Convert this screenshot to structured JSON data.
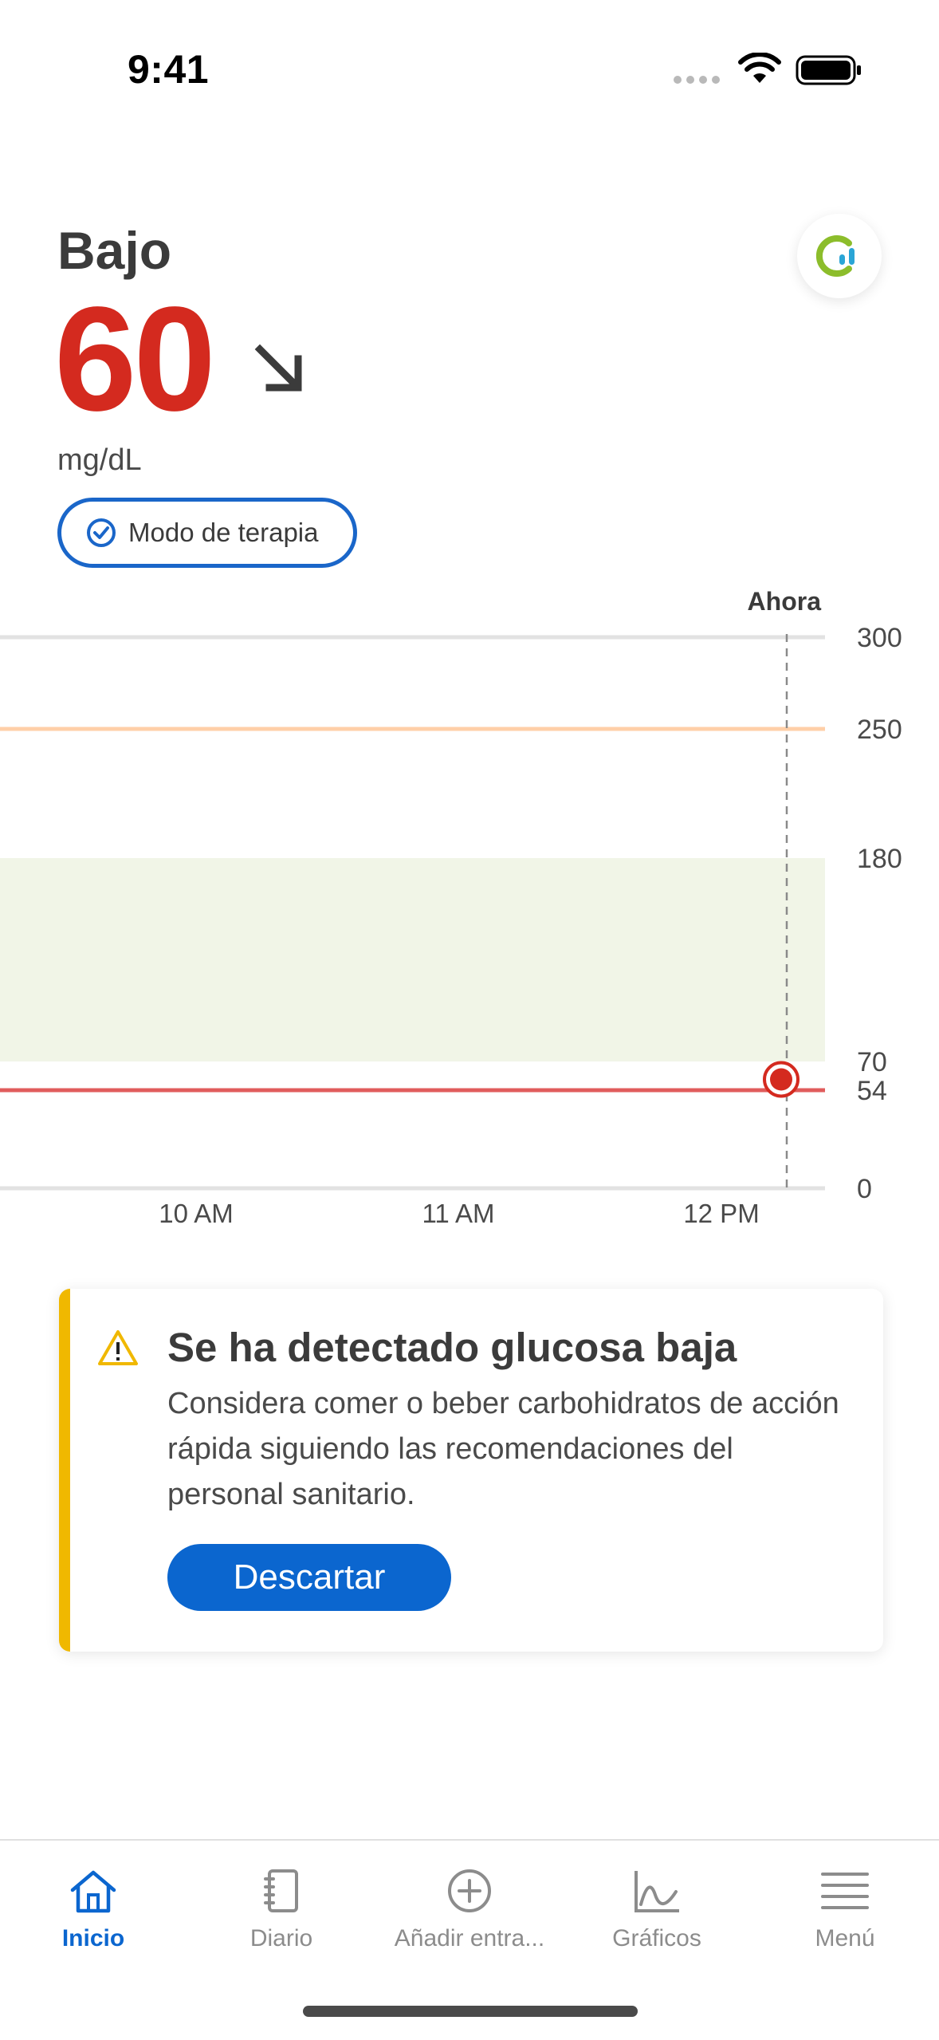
{
  "status_bar": {
    "time": "9:41"
  },
  "glucose": {
    "status": "Bajo",
    "value": "60",
    "unit": "mg/dL",
    "trend_icon": "arrow-down-right-icon",
    "therapy_mode_label": "Modo de terapia"
  },
  "chart_data": {
    "type": "line",
    "now_label": "Ahora",
    "x_tick_labels": [
      "10 AM",
      "11 AM",
      "12 PM"
    ],
    "y_tick_labels": [
      "300",
      "250",
      "180",
      "70",
      "54",
      "0"
    ],
    "ylim": [
      0,
      300
    ],
    "target_range": [
      70,
      180
    ],
    "high_threshold": 250,
    "low_threshold": 54,
    "current_point": {
      "x": "12:38 PM",
      "y": 60
    },
    "colors": {
      "high_line": "#ffcfa8",
      "low_line": "#e05c5c",
      "target_band": "#f1f5e7",
      "point": "#d42a1f"
    }
  },
  "alert": {
    "icon": "warning-icon",
    "title": "Se ha detectado glucosa baja",
    "body": "Considera comer o beber carbohidratos de acción rápida siguiendo las recomendaciones del personal sanitario.",
    "button_label": "Descartar",
    "accent_color": "#f0b800"
  },
  "tabs": [
    {
      "label": "Inicio",
      "icon": "home-icon",
      "active": true
    },
    {
      "label": "Diario",
      "icon": "logbook-icon",
      "active": false
    },
    {
      "label": "Añadir entra...",
      "icon": "add-circle-icon",
      "active": false
    },
    {
      "label": "Gráficos",
      "icon": "chart-icon",
      "active": false
    },
    {
      "label": "Menú",
      "icon": "menu-icon",
      "active": false
    }
  ],
  "colors": {
    "accent": "#0b66cf",
    "low_value": "#d42a1f"
  }
}
